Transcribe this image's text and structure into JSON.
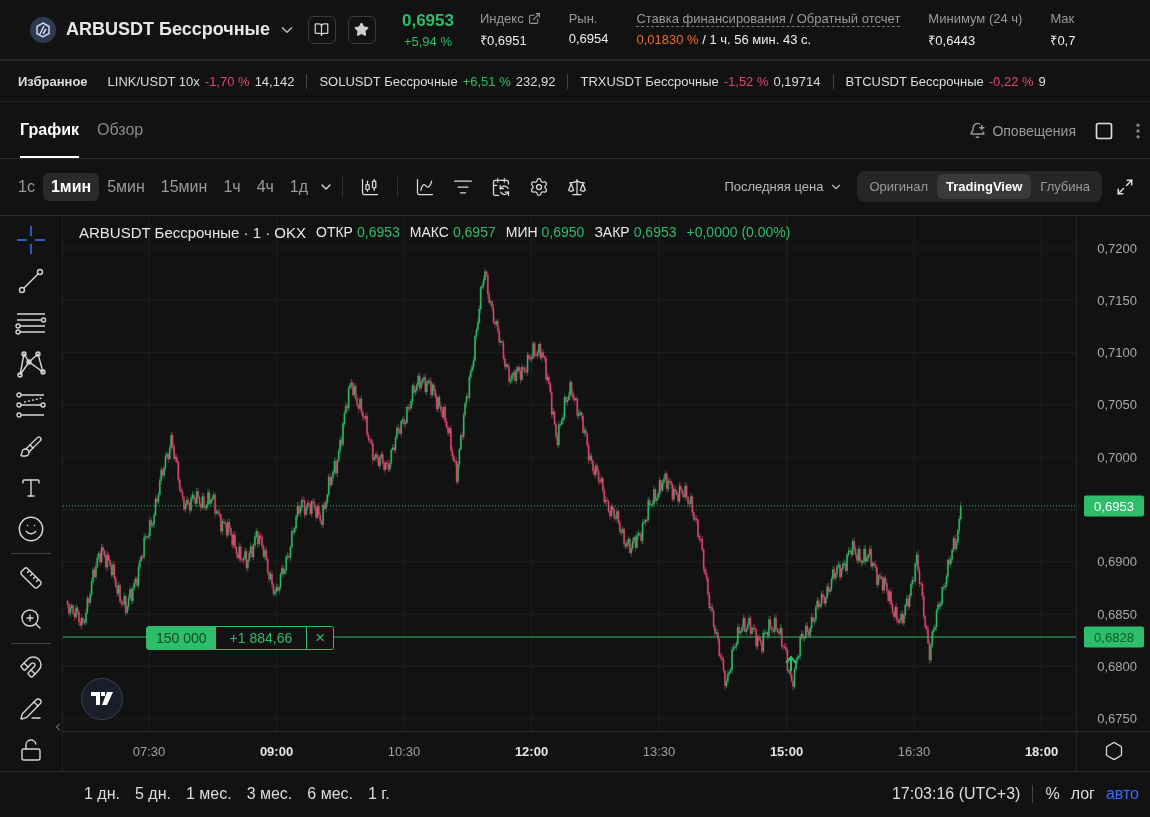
{
  "header": {
    "symbol": "ARBUSDT Бессрочные",
    "last_price": "0,6953",
    "change": "+5,94 %",
    "stats": [
      {
        "kind": "link",
        "label": "Индекс",
        "value": "₹0,6951"
      },
      {
        "kind": "plain",
        "label": "Рын.",
        "value": "0,6954"
      },
      {
        "kind": "funding",
        "label": "Ставка финансирования / Обратный отсчет",
        "value": "0,01830 %",
        "extra": "/ 1 ч. 56 мин. 43 с."
      },
      {
        "kind": "plain",
        "label": "Минимум (24 ч)",
        "value": "₹0,6443"
      },
      {
        "kind": "plain",
        "label": "Мак",
        "value": "₹0,7"
      }
    ]
  },
  "favorites": {
    "title": "Избранное",
    "items": [
      {
        "name": "LINK/USDT 10x",
        "change": "-1,70 %",
        "color": "#e0466f",
        "price": "14,142"
      },
      {
        "name": "SOLUSDT Бессрочные",
        "change": "+6,51 %",
        "color": "#2ebd6b",
        "price": "232,92"
      },
      {
        "name": "TRXUSDT Бессрочные",
        "change": "-1,52 %",
        "color": "#e0466f",
        "price": "0,19714"
      },
      {
        "name": "BTCUSDT Бессрочные",
        "change": "-0,22 %",
        "color": "#e0466f",
        "price": "9"
      }
    ]
  },
  "tabs": [
    {
      "label": "График",
      "selected": true
    },
    {
      "label": "Обзор",
      "selected": false
    }
  ],
  "alerts": "Оповещения",
  "intervals": [
    {
      "label": "1с",
      "selected": false
    },
    {
      "label": "1мин",
      "selected": true
    },
    {
      "label": "5мин",
      "selected": false
    },
    {
      "label": "15мин",
      "selected": false
    },
    {
      "label": "1ч",
      "selected": false
    },
    {
      "label": "4ч",
      "selected": false
    },
    {
      "label": "1д",
      "selected": false
    }
  ],
  "price_source": "Последняя цена",
  "views": [
    {
      "label": "Оригинал",
      "selected": false
    },
    {
      "label": "TradingView",
      "selected": true
    },
    {
      "label": "Глубина",
      "selected": false
    }
  ],
  "legend": {
    "title": "ARBUSDT Бессрочные · 1 · OKX",
    "values": [
      {
        "label": "ОТКР",
        "value": "0,6953"
      },
      {
        "label": "МАКС",
        "value": "0,6957"
      },
      {
        "label": "МИН",
        "value": "0,6950"
      },
      {
        "label": "ЗАКР",
        "value": "0,6953"
      }
    ],
    "change": "+0,0000 (0.00%)"
  },
  "tools": [
    {
      "kind": "crosshair",
      "selected": true
    },
    {
      "kind": "trendline",
      "selected": false
    },
    {
      "kind": "channel",
      "selected": false
    },
    {
      "kind": "pattern",
      "selected": false
    },
    {
      "kind": "fib",
      "selected": false
    },
    {
      "kind": "brush",
      "selected": false
    },
    {
      "kind": "text",
      "selected": false
    },
    {
      "kind": "emoji",
      "selected": false
    },
    {
      "kind": "divider"
    },
    {
      "kind": "ruler",
      "selected": false
    },
    {
      "kind": "zoom",
      "selected": false
    },
    {
      "kind": "divider"
    },
    {
      "kind": "magnet",
      "selected": false
    },
    {
      "kind": "lockdraw",
      "selected": false
    },
    {
      "kind": "unlock",
      "selected": false
    }
  ],
  "position": {
    "quantity": "150 000",
    "pnl": "+1 884,66",
    "close": "×"
  },
  "price_axis": [
    "0,7200",
    "0,7150",
    "0,7100",
    "0,7050",
    "0,7000",
    "0,6900",
    "0,6850",
    "0,6800",
    "0,6750"
  ],
  "price_tags": [
    {
      "kind": "last",
      "value": "0,6953"
    },
    {
      "kind": "position",
      "value": "0,6828"
    }
  ],
  "time_axis": [
    {
      "label": "07:30",
      "emphasized": false
    },
    {
      "label": "09:00",
      "emphasized": true
    },
    {
      "label": "10:30",
      "emphasized": false
    },
    {
      "label": "12:00",
      "emphasized": true
    },
    {
      "label": "13:30",
      "emphasized": false
    },
    {
      "label": "15:00",
      "emphasized": true
    },
    {
      "label": "16:30",
      "emphasized": false
    },
    {
      "label": "18:00",
      "emphasized": true
    }
  ],
  "ranges": [
    "1 дн.",
    "5 дн.",
    "1 мес.",
    "3 мес.",
    "6 мес.",
    "1 г."
  ],
  "clock": "17:03:16 (UTC+3)",
  "scale_options": [
    {
      "label": "%",
      "selected": false
    },
    {
      "label": "лог",
      "selected": false
    },
    {
      "label": "авто",
      "selected": true
    }
  ]
}
